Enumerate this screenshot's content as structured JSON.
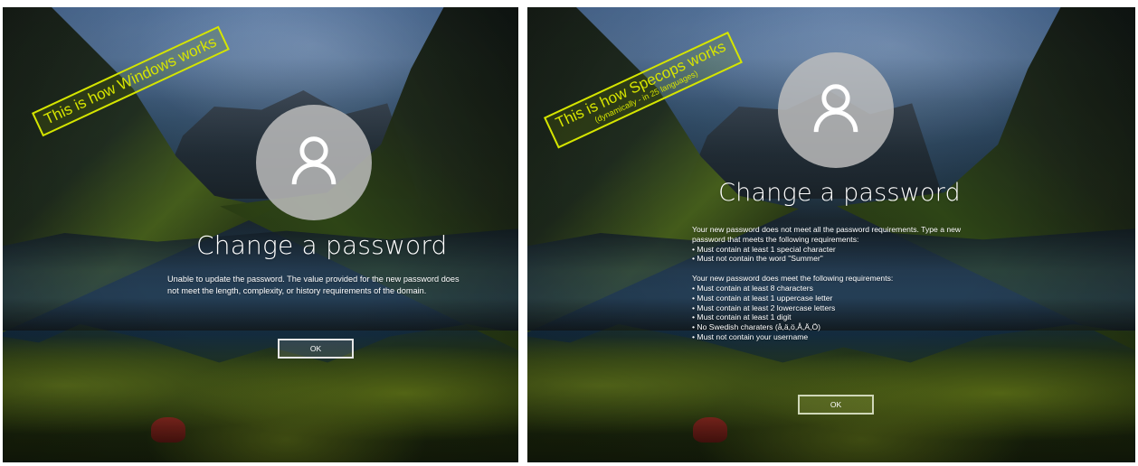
{
  "colors": {
    "stamp": "#d5e500",
    "button_border": "#e6e6e6",
    "text": "#ffffff",
    "avatar_bg": "#bebebe"
  },
  "left_panel": {
    "stamp_text": "This is how Windows works",
    "avatar_icon": "user-icon",
    "title": "Change a password",
    "message": "Unable to update the password. The value provided for the new password does not meet the length, complexity, or history requirements of the domain.",
    "button_label": "OK"
  },
  "right_panel": {
    "stamp_text": "This is how Specops works",
    "stamp_subtext": "(dynamically - in 25 languages)",
    "avatar_icon": "user-icon",
    "title": "Change a password",
    "requirements_intro": "Your new password does not meet all the password requirements. Type a new password that meets the following requirements:",
    "unmet_requirements": [
      "Must contain at least 1 special character",
      "Must not contain the word \"Summer\""
    ],
    "met_intro": "Your new password does meet the following requirements:",
    "met_requirements": [
      "Must contain at least 8 characters",
      "Must contain at least 1 uppercase letter",
      "Must contain at least 2 lowercase letters",
      "Must contain at least 1 digit",
      "No Swedish charaters (å,ä,ö,Å,Ä,Ö)",
      "Must not contain your username"
    ],
    "button_label": "OK"
  }
}
